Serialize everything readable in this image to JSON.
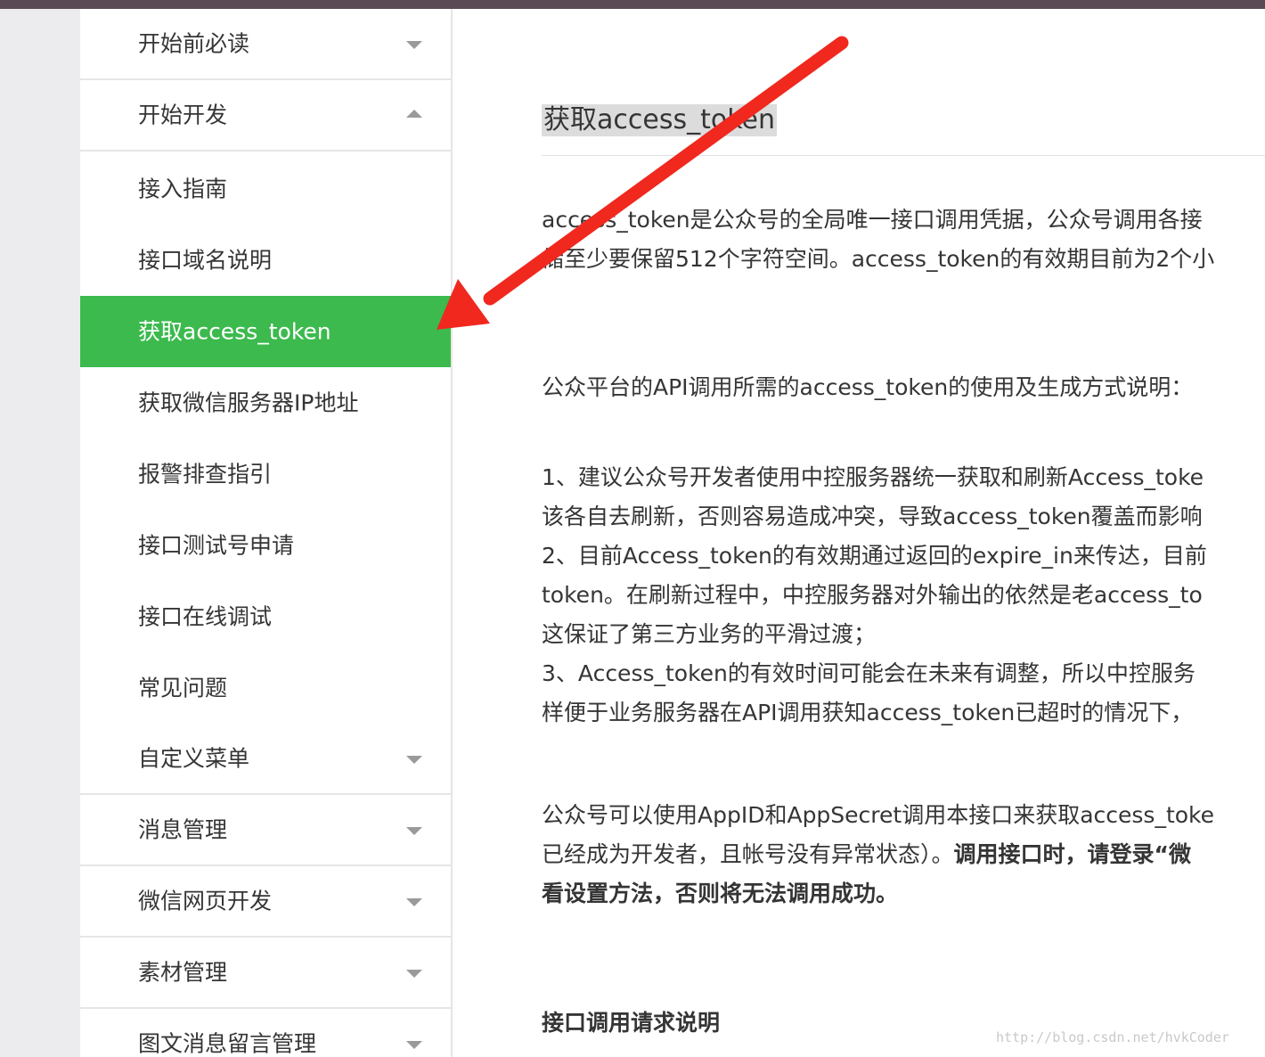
{
  "sidebar": {
    "group_start_reading": "开始前必读",
    "group_start_dev": "开始开发",
    "sub_items": [
      "接入指南",
      "接口域名说明",
      "获取access_token",
      "获取微信服务器IP地址",
      "报警排查指引",
      "接口测试号申请",
      "接口在线调试",
      "常见问题"
    ],
    "group_custom_menu": "自定义菜单",
    "group_message": "消息管理",
    "group_webpage": "微信网页开发",
    "group_material": "素材管理",
    "group_comment": "图文消息留言管理"
  },
  "content": {
    "title": "获取access_token",
    "para1": [
      "access_token是公众号的全局唯一接口调用凭据，公众号调用各接",
      "储至少要保留512个字符空间。access_token的有效期目前为2个小"
    ],
    "para2": "公众平台的API调用所需的access_token的使用及生成方式说明：",
    "para3": [
      "1、建议公众号开发者使用中控服务器统一获取和刷新Access_toke",
      "该各自去刷新，否则容易造成冲突，导致access_token覆盖而影响",
      "2、目前Access_token的有效期通过返回的expire_in来传达，目前",
      "token。在刷新过程中，中控服务器对外输出的依然是老access_to",
      "这保证了第三方业务的平滑过渡；",
      "3、Access_token的有效时间可能会在未来有调整，所以中控服务",
      "样便于业务服务器在API调用获知access_token已超时的情况下，"
    ],
    "para4_line1": "公众号可以使用AppID和AppSecret调用本接口来获取access_toke",
    "para4_line2_normal": "已经成为开发者，且帐号没有异常状态）。",
    "para4_line2_bold": "调用接口时，请登录“微",
    "para4_line3_bold": "看设置方法，否则将无法调用成功。",
    "section_heading": "接口调用请求说明"
  },
  "watermark": "http://blog.csdn.net/hvkCoder",
  "colors": {
    "active_green": "#3cba4e",
    "arrow_red": "#f0281e",
    "top_bar": "#5a4a55",
    "gutter": "#ececee"
  }
}
